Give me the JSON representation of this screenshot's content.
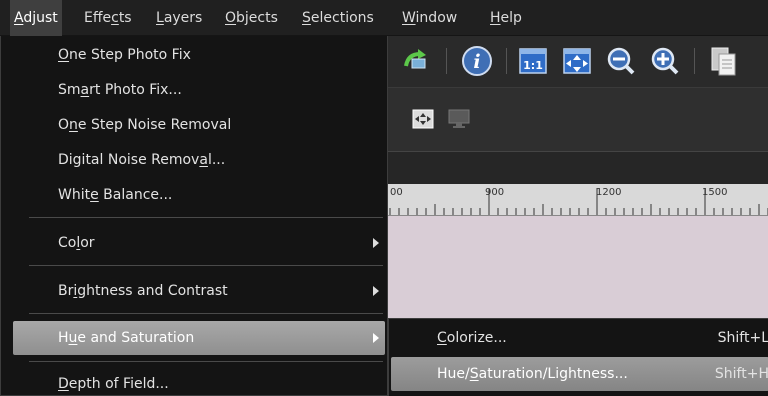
{
  "menubar": {
    "items": [
      {
        "label": "Adjust",
        "mnemonic": "A"
      },
      {
        "label": "Effects",
        "mnemonic": "c"
      },
      {
        "label": "Layers",
        "mnemonic": "L"
      },
      {
        "label": "Objects",
        "mnemonic": "O"
      },
      {
        "label": "Selections",
        "mnemonic": "S"
      },
      {
        "label": "Window",
        "mnemonic": "W"
      },
      {
        "label": "Help",
        "mnemonic": "H"
      }
    ],
    "active": "Adjust"
  },
  "toolbar": {
    "icons": [
      "rotate-icon",
      "info-icon",
      "actual-size-icon",
      "fit-window-icon",
      "zoom-out-icon",
      "zoom-in-icon",
      "paste-icon"
    ]
  },
  "toolbar2": {
    "icons": [
      "fit-icon",
      "screen-icon"
    ]
  },
  "ruler": {
    "labels": [
      "00",
      "900",
      "1200",
      "1500"
    ]
  },
  "colors": {
    "highlight": "#9a9a9a",
    "menu_bg": "#141414",
    "canvas": "#d9cdd6"
  },
  "adjust_menu": {
    "items": [
      {
        "label": "One Step Photo Fix",
        "mnemonic_index": 0,
        "submenu": false
      },
      {
        "label": "Smart Photo Fix...",
        "mnemonic_index": 2,
        "submenu": false
      },
      {
        "label": "One Step Noise Removal",
        "mnemonic_index": 1,
        "submenu": false
      },
      {
        "label": "Digital Noise Removal...",
        "mnemonic_index": 19,
        "submenu": false
      },
      {
        "label": "White Balance...",
        "mnemonic_index": 4,
        "submenu": false
      },
      {
        "label": "Color",
        "mnemonic_index": 2,
        "submenu": true
      },
      {
        "label": "Brightness and Contrast",
        "mnemonic_index": 2,
        "submenu": true
      },
      {
        "label": "Hue and Saturation",
        "mnemonic_index": 1,
        "submenu": true,
        "highlighted": true
      },
      {
        "label": "Depth of Field...",
        "mnemonic_index": 0,
        "submenu": false
      }
    ]
  },
  "hue_submenu": {
    "items": [
      {
        "label": "Colorize...",
        "mnemonic_index": 0,
        "shortcut": "Shift+L"
      },
      {
        "label": "Hue/Saturation/Lightness...",
        "mnemonic_index": 4,
        "shortcut": "Shift+H",
        "highlighted": true
      }
    ]
  }
}
